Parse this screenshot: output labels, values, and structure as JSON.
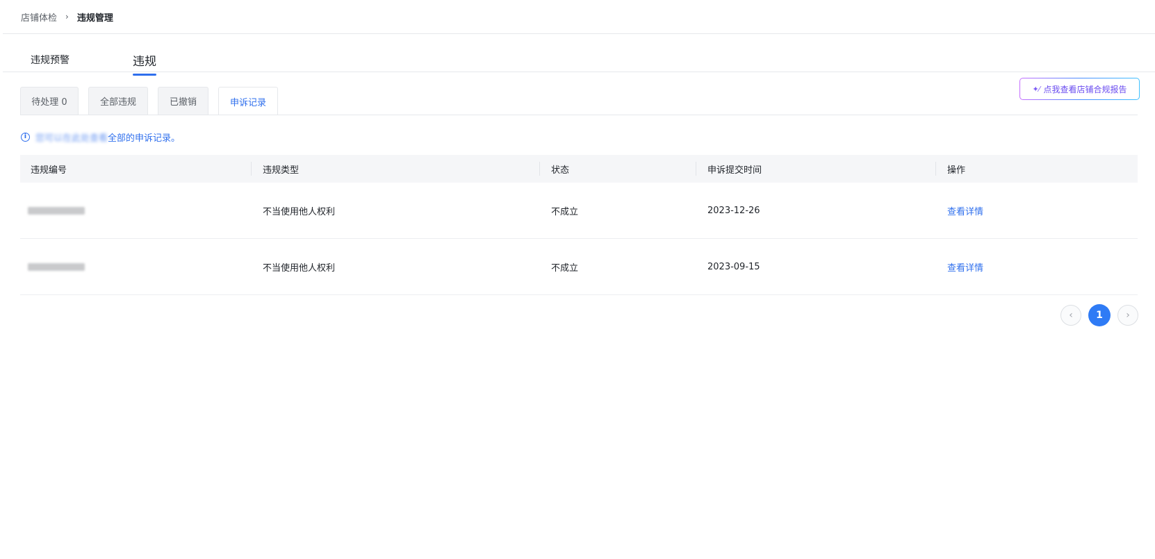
{
  "breadcrumb": {
    "parent": "店铺体检",
    "separator": "›",
    "current": "违规管理"
  },
  "main_tabs": [
    {
      "label": "违规预警"
    },
    {
      "label": "违规"
    }
  ],
  "sub_tabs": [
    {
      "label": "待处理 0"
    },
    {
      "label": "全部违规"
    },
    {
      "label": "已撤销"
    },
    {
      "label": "申诉记录"
    }
  ],
  "report_button": {
    "icon": "✦⁄",
    "label": "点我查看店铺合规报告"
  },
  "notice": {
    "icon": "i",
    "blurred_prefix": "您可以在此处查看",
    "text": "全部的申诉记录。"
  },
  "table": {
    "columns": [
      "违规编号",
      "违规类型",
      "状态",
      "申诉提交时间",
      "操作"
    ],
    "rows": [
      {
        "type": "不当使用他人权利",
        "status": "不成立",
        "time": "2023-12-26",
        "action": "查看详情"
      },
      {
        "type": "不当使用他人权利",
        "status": "不成立",
        "time": "2023-09-15",
        "action": "查看详情"
      }
    ]
  },
  "pagination": {
    "prev": "‹",
    "current": "1",
    "next": "›"
  },
  "colors": {
    "accent": "#2f6fed",
    "page_active": "#2f7bf5"
  }
}
